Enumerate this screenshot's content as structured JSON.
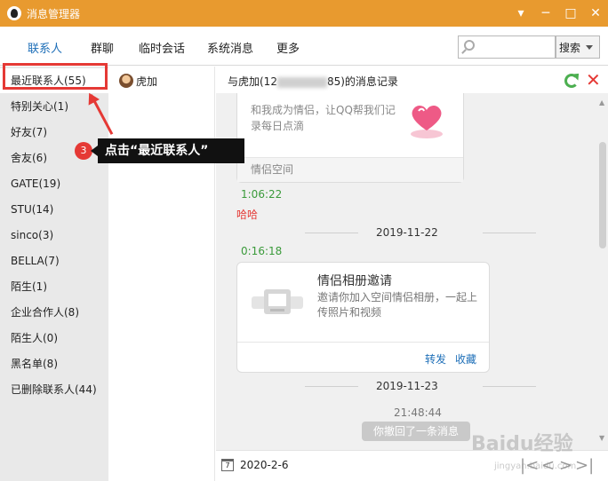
{
  "window": {
    "title": "消息管理器",
    "controls": [
      "▾",
      "─",
      "□",
      "✕"
    ]
  },
  "tabs": [
    {
      "label": "联系人",
      "active": true
    },
    {
      "label": "群聊"
    },
    {
      "label": "临时会话"
    },
    {
      "label": "系统消息"
    },
    {
      "label": "更多"
    }
  ],
  "search": {
    "placeholder": "",
    "button_label": "搜索"
  },
  "sidebar": {
    "items": [
      {
        "label": "最近联系人(55)"
      },
      {
        "label": "特别关心(1)"
      },
      {
        "label": "好友(7)"
      },
      {
        "label": "舍友(6)"
      },
      {
        "label": "GATE(19)"
      },
      {
        "label": "STU(14)"
      },
      {
        "label": "sinco(3)"
      },
      {
        "label": "BELLA(7)"
      },
      {
        "label": "陌生(1)"
      },
      {
        "label": "企业合作人(8)"
      },
      {
        "label": "陌生人(0)"
      },
      {
        "label": "黑名单(8)"
      },
      {
        "label": "已删除联系人(44)"
      }
    ]
  },
  "contacts": [
    {
      "name": "虎加"
    }
  ],
  "record": {
    "title_prefix": "与虎加(12",
    "title_suffix": "85)的消息记录"
  },
  "messages": {
    "card1": {
      "text": "和我成为情侣，让QQ帮我们记录每日点滴",
      "footer": "情侣空间"
    },
    "time1": "1:06:22",
    "msg1": "哈哈",
    "date1": "2019-11-22",
    "time2": "0:16:18",
    "card2": {
      "title": "情侣相册邀请",
      "desc": "邀请你加入空间情侣相册，一起上传照片和视频",
      "forward": "转发",
      "favorite": "收藏"
    },
    "date2": "2019-11-23",
    "time3": "21:48:44",
    "recall": "你撤回了一条消息"
  },
  "bottom": {
    "calendar_day": "7",
    "date": "2020-2-6",
    "pager": [
      "|<",
      "<",
      ">",
      ">|"
    ]
  },
  "annotation": {
    "step": "3",
    "text": "点击“最近联系人”"
  },
  "watermark": {
    "text": "Baidu经验",
    "url": "jingyan.baidu.com"
  },
  "colors": {
    "titlebar": "#e89a2f",
    "accent": "#1e6fb8",
    "highlight": "#e53935",
    "time_green": "#3a9a3a"
  }
}
